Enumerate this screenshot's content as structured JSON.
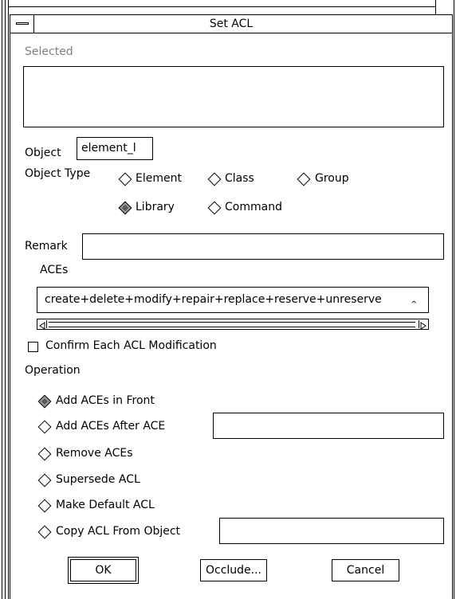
{
  "window": {
    "title": "Set ACL"
  },
  "selected": {
    "label": "Selected"
  },
  "object": {
    "label": "Object",
    "value": "element_l"
  },
  "object_type": {
    "label": "Object Type",
    "options": [
      {
        "label": "Element",
        "selected": false
      },
      {
        "label": "Class",
        "selected": false
      },
      {
        "label": "Group",
        "selected": false
      },
      {
        "label": "Library",
        "selected": true
      },
      {
        "label": "Command",
        "selected": false
      }
    ]
  },
  "remark": {
    "label": "Remark",
    "value": ""
  },
  "aces": {
    "label": "ACEs",
    "value": "create+delete+modify+repair+replace+reserve+unreserve"
  },
  "confirm": {
    "label": "Confirm Each ACL Modification",
    "checked": false
  },
  "operation": {
    "label": "Operation",
    "options": [
      {
        "label": "Add ACEs in Front",
        "selected": true
      },
      {
        "label": "Add ACEs After ACE",
        "selected": false
      },
      {
        "label": "Remove ACEs",
        "selected": false
      },
      {
        "label": "Supersede ACL",
        "selected": false
      },
      {
        "label": "Make Default ACL",
        "selected": false
      },
      {
        "label": "Copy ACL From Object",
        "selected": false
      }
    ]
  },
  "buttons": {
    "ok": "OK",
    "occlude": "Occlude...",
    "cancel": "Cancel"
  }
}
